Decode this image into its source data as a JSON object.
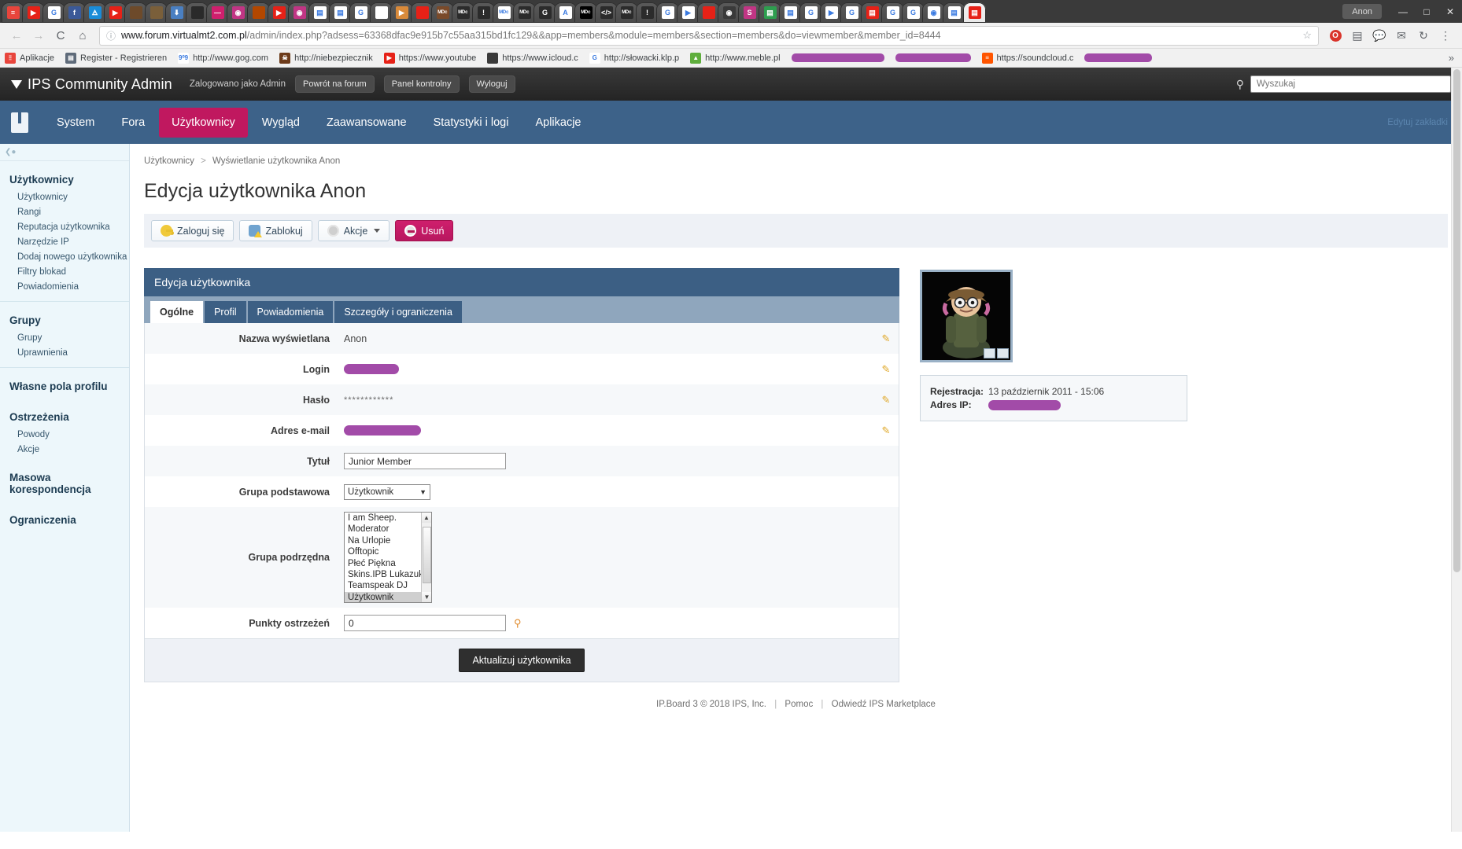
{
  "browser": {
    "window_user": "Anon",
    "url_host": "www.forum.virtualmt2.com.pl",
    "url_path": "/admin/index.php?adsess=63368dfac9e915b7c55aa315bd1fc129&&app=members&module=members&section=members&do=viewmember&member_id=8444",
    "back_icon": "←",
    "forward_icon": "→",
    "reload_icon": "C",
    "home_icon": "⌂",
    "info_icon": "ⓘ",
    "star_icon": "☆",
    "opera_icon": "O",
    "extension_icon": "▤",
    "comment_icon": "💬",
    "mail_icon": "✉",
    "sync_icon": "↻",
    "menu_icon": "⋮",
    "minimize_icon": "—",
    "maximize_icon": "□",
    "close_icon": "✕",
    "overflow_icon": "»",
    "bookmarks": [
      {
        "label": "Aplikacje",
        "icon": "apps-grid-icon",
        "color": "#e8453c",
        "glyph": "⦙⦙"
      },
      {
        "label": "Register - Registrieren",
        "icon": "site-icon",
        "color": "#5f6b7a",
        "glyph": "▤"
      },
      {
        "label": "http://www.gog.com",
        "icon": "gog-icon",
        "color": "#ffffff",
        "glyph": "9⁰9"
      },
      {
        "label": "http://niebezpiecznik",
        "icon": "niebezpiecznik-icon",
        "color": "#6d3b1a",
        "glyph": "☠"
      },
      {
        "label": "https://www.youtube",
        "icon": "youtube-icon",
        "color": "#e62117",
        "glyph": "▶"
      },
      {
        "label": "https://www.icloud.c",
        "icon": "apple-icon",
        "color": "#3a3a3a",
        "glyph": ""
      },
      {
        "label": "http://słowacki.klp.p",
        "icon": "google-icon",
        "color": "#ffffff",
        "glyph": "G"
      },
      {
        "label": "http://www.meble.pl",
        "icon": "meble-icon",
        "color": "#5fae3d",
        "glyph": "▲"
      },
      {
        "label": "",
        "icon": "redacted-bookmark-icon",
        "color": "#a24ba8",
        "glyph": "",
        "redacted": true
      },
      {
        "label": "",
        "icon": "redacted-bookmark-icon",
        "color": "#a24ba8",
        "glyph": "",
        "redacted": true
      },
      {
        "label": "https://soundcloud.c",
        "icon": "soundcloud-icon",
        "color": "#ff5500",
        "glyph": "≡"
      },
      {
        "label": "",
        "icon": "redacted-bookmark-icon",
        "color": "#a24ba8",
        "glyph": "",
        "redacted": true
      }
    ]
  },
  "header": {
    "brand": "IPS Community Admin",
    "logged_as": "Zalogowano jako Admin",
    "buttons": [
      "Powrót na forum",
      "Panel kontrolny",
      "Wyloguj"
    ],
    "search_placeholder": "Wyszukaj",
    "search_value": "",
    "search_icon": "search-icon"
  },
  "nav": {
    "items": [
      {
        "label": "System",
        "active": false
      },
      {
        "label": "Fora",
        "active": false
      },
      {
        "label": "Użytkownicy",
        "active": true
      },
      {
        "label": "Wygląd",
        "active": false
      },
      {
        "label": "Zaawansowane",
        "active": false
      },
      {
        "label": "Statystyki i logi",
        "active": false
      },
      {
        "label": "Aplikacje",
        "active": false
      }
    ],
    "edit_tabs": "Edytuj zakładki"
  },
  "sidebar": {
    "collapse_icon": "collapse-left-icon",
    "groups": [
      {
        "title": "Użytkownicy",
        "links": [
          "Użytkownicy",
          "Rangi",
          "Reputacja użytkownika",
          "Narzędzie IP",
          "Dodaj nowego użytkownika",
          "Filtry blokad",
          "Powiadomienia"
        ]
      },
      {
        "title": "Grupy",
        "links": [
          "Grupy",
          "Uprawnienia"
        ]
      },
      {
        "title": "Własne pola profilu",
        "links": []
      },
      {
        "title": "Ostrzeżenia",
        "links": [
          "Powody",
          "Akcje"
        ]
      },
      {
        "title": "Masowa korespondencja",
        "links": []
      },
      {
        "title": "Ograniczenia",
        "links": []
      }
    ]
  },
  "main": {
    "breadcrumb": {
      "root": "Użytkownicy",
      "separator": ">",
      "current": "Wyświetlanie użytkownika Anon"
    },
    "page_title": "Edycja użytkownika Anon",
    "actions": [
      {
        "label": "Zaloguj się",
        "icon": "key-icon",
        "style": "default"
      },
      {
        "label": "Zablokuj",
        "icon": "user-warning-icon",
        "style": "default"
      },
      {
        "label": "Akcje",
        "icon": "gear-icon",
        "style": "default",
        "has_caret": true
      },
      {
        "label": "Usuń",
        "icon": "delete-circle-icon",
        "style": "danger"
      }
    ],
    "panel_title": "Edycja użytkownika",
    "tabs": [
      {
        "label": "Ogólne",
        "active": true
      },
      {
        "label": "Profil",
        "active": false
      },
      {
        "label": "Powiadomienia",
        "active": false
      },
      {
        "label": "Szczegóły i ograniczenia",
        "active": false
      }
    ],
    "fields": {
      "display_name": {
        "label": "Nazwa wyświetlana",
        "value": "Anon"
      },
      "login": {
        "label": "Login",
        "value": "",
        "redacted": true
      },
      "password": {
        "label": "Hasło",
        "value": "************"
      },
      "email": {
        "label": "Adres e-mail",
        "value": "",
        "redacted": true
      },
      "title": {
        "label": "Tytuł",
        "value": "Junior Member"
      },
      "primary_group": {
        "label": "Grupa podstawowa",
        "value": "Użytkownik"
      },
      "secondary_group": {
        "label": "Grupa podrzędna",
        "options": [
          "I am Sheep.",
          "Moderator",
          "Na Urlopie",
          "Offtopic",
          "Płeć Piękna",
          "Skins.IPB Lukazuki",
          "Teamspeak DJ",
          "Użytkownik"
        ],
        "selected": "Użytkownik"
      },
      "warn_points": {
        "label": "Punkty ostrzeżeń",
        "value": "0",
        "search_icon": "magnifier-icon"
      }
    },
    "submit_label": "Aktualizuj użytkownika"
  },
  "side": {
    "avatar_name": "user-avatar",
    "registration": {
      "label": "Rejestracja:",
      "value": "13 październik 2011 - 15:06"
    },
    "ip": {
      "label": "Adres IP:",
      "value": "",
      "redacted": true
    }
  },
  "footer": {
    "copyright": "IP.Board 3 © 2018 IPS, Inc.",
    "separator": "|",
    "links": [
      "Pomoc",
      "Odwiedź IPS Marketplace"
    ]
  }
}
